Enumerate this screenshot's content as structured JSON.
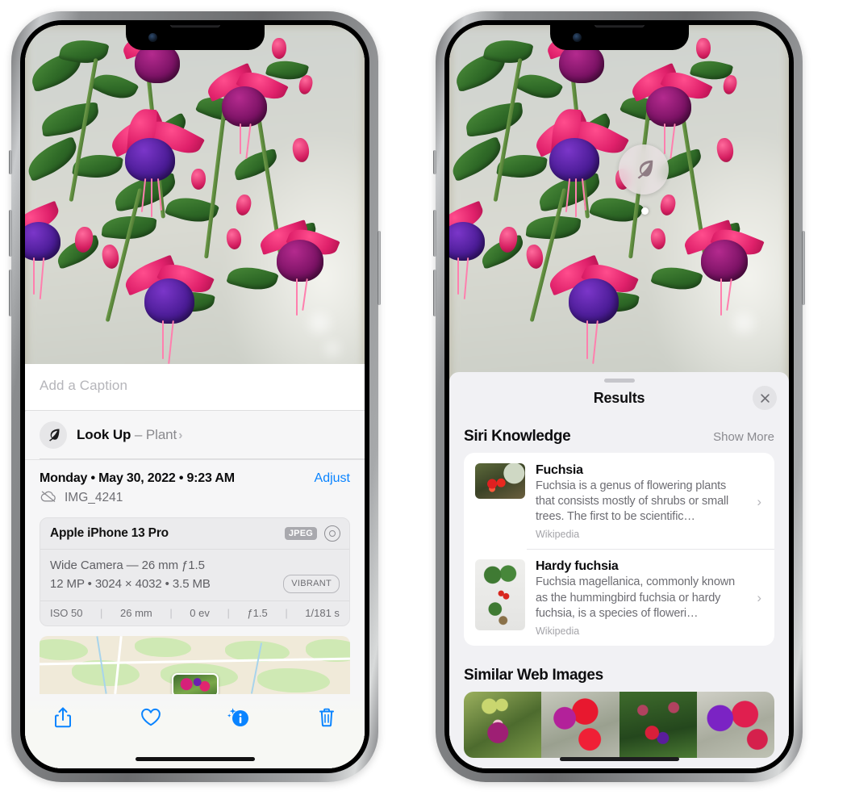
{
  "left_phone": {
    "photo_alt": "Fuchsia flowers hanging basket",
    "caption": {
      "placeholder": "Add a Caption",
      "value": ""
    },
    "look_up": {
      "icon": "leaf-icon",
      "label": "Look Up",
      "dash": "–",
      "subject": "Plant",
      "chevron": "›"
    },
    "date_row": {
      "date": "Monday • May 30, 2022 • 9:23 AM",
      "adjust_label": "Adjust"
    },
    "file_row": {
      "icon": "cloud-slash-icon",
      "filename": "IMG_4241"
    },
    "exif": {
      "device": "Apple iPhone 13 Pro",
      "format_badge": "JPEG",
      "raw_icon": "aperture-icon",
      "lens_line": "Wide Camera — 26 mm ƒ1.5",
      "size_line": "12 MP • 3024 × 4032 • 3.5 MB",
      "style_badge": "VIBRANT",
      "stats": [
        "ISO 50",
        "26 mm",
        "0 ev",
        "ƒ1.5",
        "1/181 s"
      ],
      "stat_separator": "|"
    },
    "map": {
      "pin_label": "photo-thumbnail-pin"
    },
    "toolbar": [
      {
        "name": "share-button",
        "icon": "share-icon"
      },
      {
        "name": "favorite-button",
        "icon": "heart-icon"
      },
      {
        "name": "info-button",
        "icon": "info-sparkle-icon"
      },
      {
        "name": "delete-button",
        "icon": "trash-icon"
      }
    ],
    "accent_color": "#0a84ff"
  },
  "right_phone": {
    "visual_lookup_badge": {
      "icon": "leaf-icon"
    },
    "results": {
      "title": "Results",
      "close_icon": "close-icon",
      "siri_knowledge": {
        "section_title": "Siri Knowledge",
        "show_more": "Show More",
        "items": [
          {
            "title": "Fuchsia",
            "description": "Fuchsia is a genus of flowering plants that consists mostly of shrubs or small trees. The first to be scientific…",
            "source": "Wikipedia",
            "thumb": "fuchsia-red-flowers-thumb",
            "chevron": "›"
          },
          {
            "title": "Hardy fuchsia",
            "description": "Fuchsia magellanica, commonly known as the hummingbird fuchsia or hardy fuchsia, is a species of floweri…",
            "source": "Wikipedia",
            "thumb": "hardy-fuchsia-specimen-thumb",
            "chevron": "›"
          }
        ]
      },
      "similar_web_images": {
        "section_title": "Similar Web Images",
        "items": [
          "fuchsia-web-image-1",
          "fuchsia-web-image-2",
          "fuchsia-web-image-3",
          "fuchsia-web-image-4"
        ]
      }
    }
  }
}
